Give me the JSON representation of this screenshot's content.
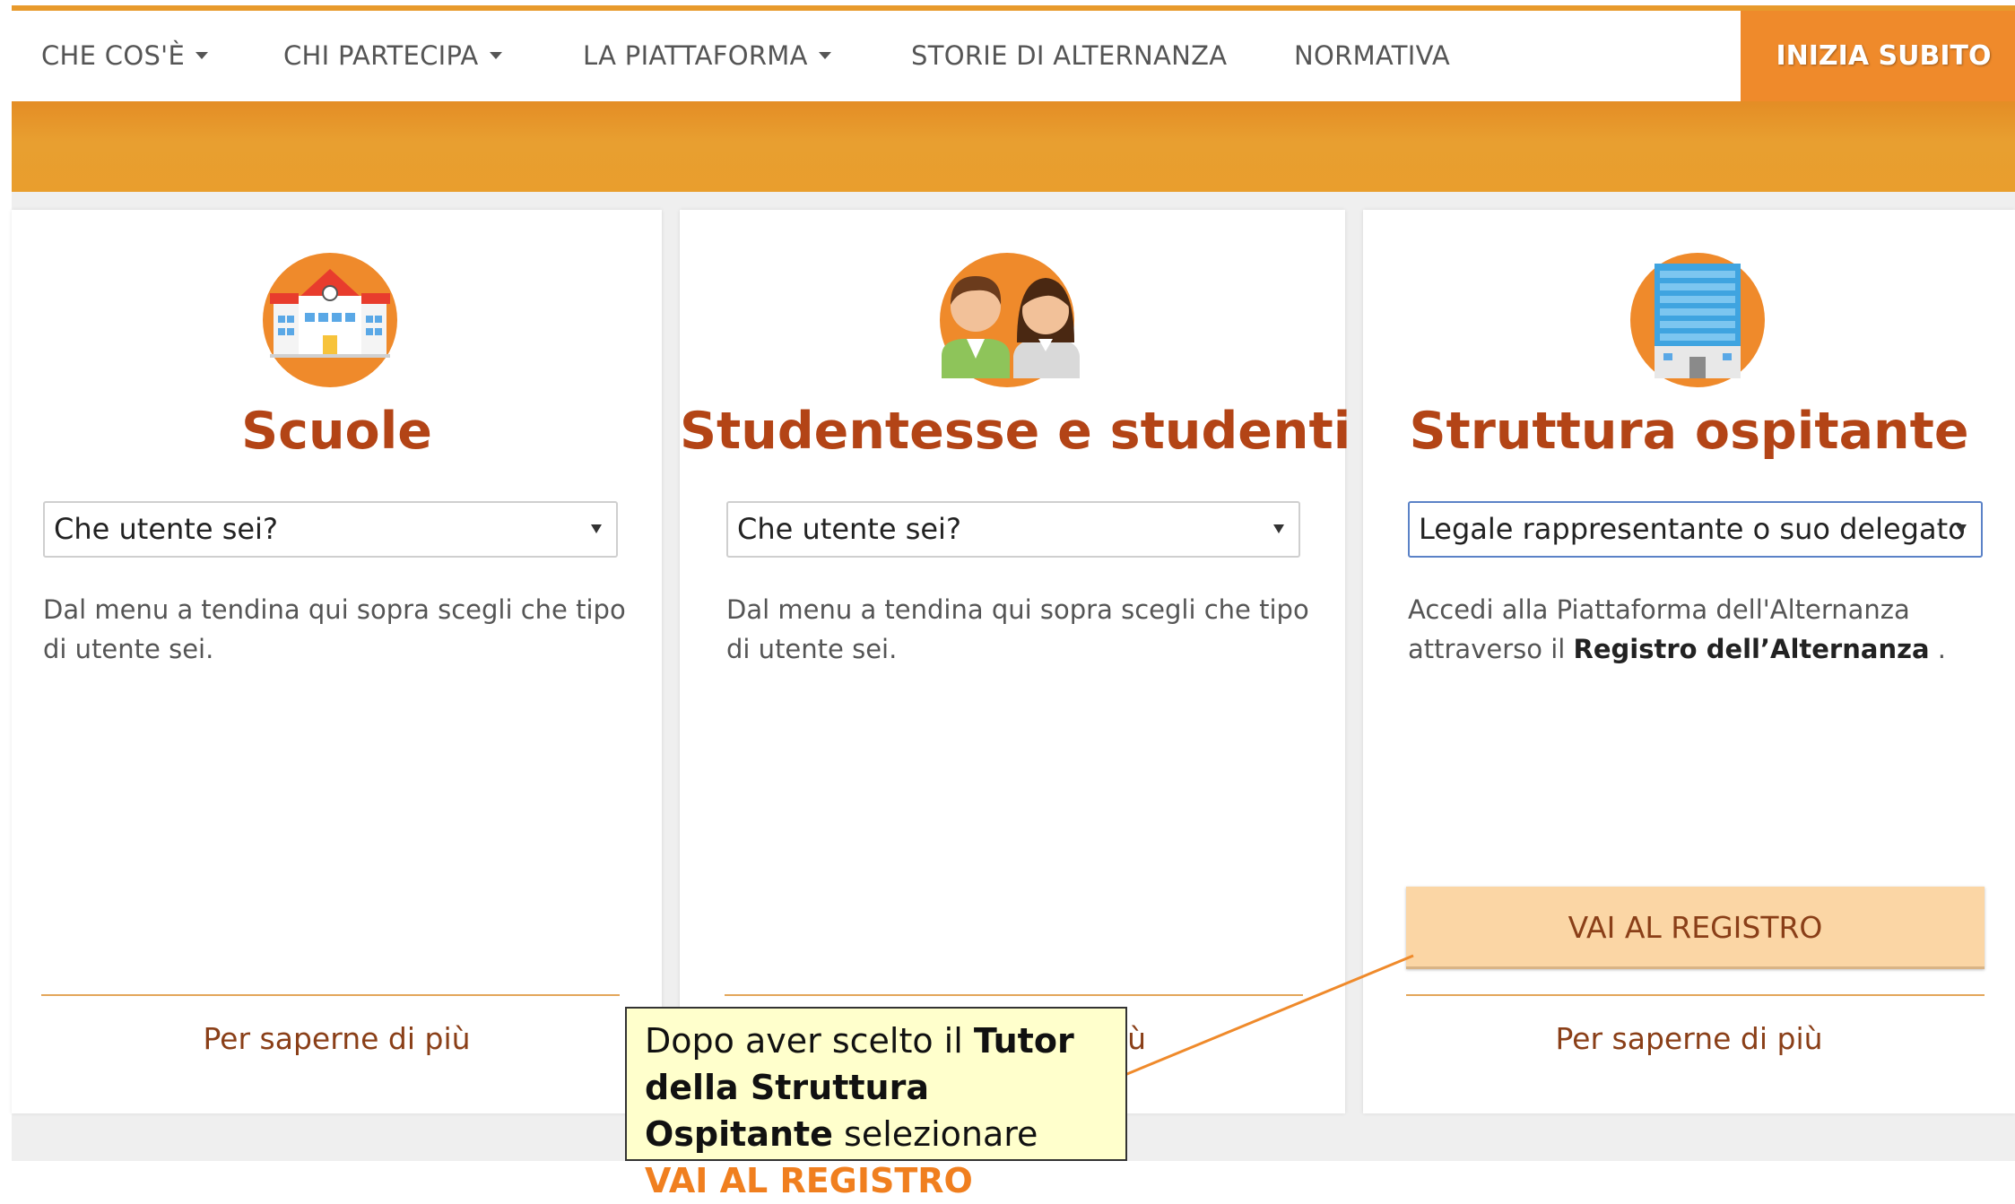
{
  "nav": {
    "items": [
      {
        "label": "CHE COS'È",
        "dropdown": true
      },
      {
        "label": "CHI PARTECIPA",
        "dropdown": true
      },
      {
        "label": "LA PIATTAFORMA",
        "dropdown": true
      },
      {
        "label": "STORIE DI ALTERNANZA",
        "dropdown": false
      },
      {
        "label": "NORMATIVA",
        "dropdown": false
      }
    ],
    "cta_label": "INIZIA SUBITO"
  },
  "cards": [
    {
      "title": "Scuole",
      "icon": "school-building-icon",
      "select_value": "Che utente sei?",
      "description": "Dal menu a tendina qui sopra scegli che tipo di utente sei.",
      "more_label": "Per saperne di più"
    },
    {
      "title": "Studentesse e studenti",
      "icon": "students-icon",
      "select_value": "Che utente sei?",
      "description": "Dal menu a tendina qui sopra scegli che tipo di utente sei.",
      "more_label": "Per saperne di più"
    },
    {
      "title": "Struttura ospitante",
      "icon": "office-building-icon",
      "select_value": "Legale rappresentante o suo delegato",
      "description_pre": "Accedi alla Piattaforma dell'Alternanza attraverso il ",
      "description_bold": "Registro dell’Alternanza",
      "description_post": " .",
      "button_label": "VAI AL REGISTRO",
      "more_label": "Per saperne di più"
    }
  ],
  "callout": {
    "text_1": "Dopo aver scelto il ",
    "bold": "Tutor della Struttura Ospitante",
    "text_2": " selezionare ",
    "highlight": "VAI AL REGISTRO"
  },
  "colors": {
    "accent": "#ef8a2b",
    "band": "#e89f30",
    "title": "#b34416",
    "link": "#8a3f18",
    "button_bg": "#fbd6a5",
    "callout_bg": "#ffffcc"
  }
}
